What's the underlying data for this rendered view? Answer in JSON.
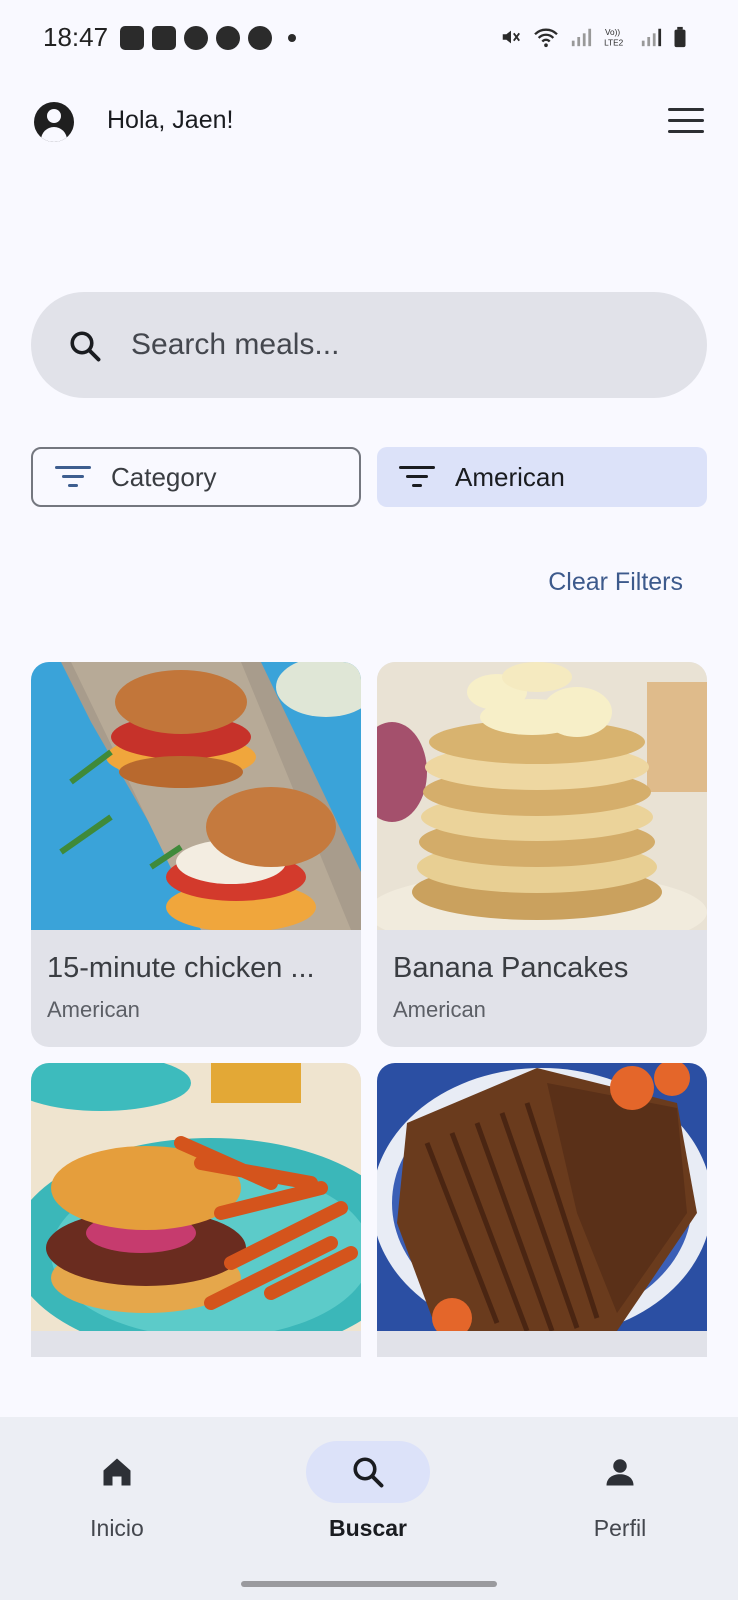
{
  "status_bar": {
    "time": "18:47",
    "left_icons": [
      "gallery-icon",
      "twitch-icon",
      "facebook-icon",
      "bowl-icon",
      "bowl-icon"
    ],
    "right_icons": [
      "mute-icon",
      "wifi-icon",
      "signal-icon",
      "volte-icon",
      "signal-icon",
      "battery-icon"
    ],
    "volte_label": "Vo)) LTE2"
  },
  "header": {
    "greeting": "Hola, Jaen!"
  },
  "search": {
    "placeholder": "Search meals..."
  },
  "filters": {
    "category_label": "Category",
    "area_label": "American",
    "clear_label": "Clear Filters"
  },
  "meals": [
    {
      "title": "15-minute chicken ...",
      "area": "American",
      "image": "chicken-burger-photo"
    },
    {
      "title": "Banana Pancakes",
      "area": "American",
      "image": "banana-pancakes-photo"
    },
    {
      "title": "",
      "area": "",
      "image": "sloppy-joe-fries-photo"
    },
    {
      "title": "",
      "area": "",
      "image": "beef-brisket-photo"
    }
  ],
  "bottom_nav": {
    "items": [
      {
        "label": "Inicio",
        "icon": "home-icon"
      },
      {
        "label": "Buscar",
        "icon": "search-icon"
      },
      {
        "label": "Perfil",
        "icon": "person-icon"
      }
    ],
    "active": "Buscar"
  },
  "colors": {
    "background": "#f9f9ff",
    "surface_variant": "#e1e2e9",
    "secondary_container": "#dce2f9",
    "primary_text_link": "#3d5a8c",
    "nav_background": "#eceef4"
  }
}
